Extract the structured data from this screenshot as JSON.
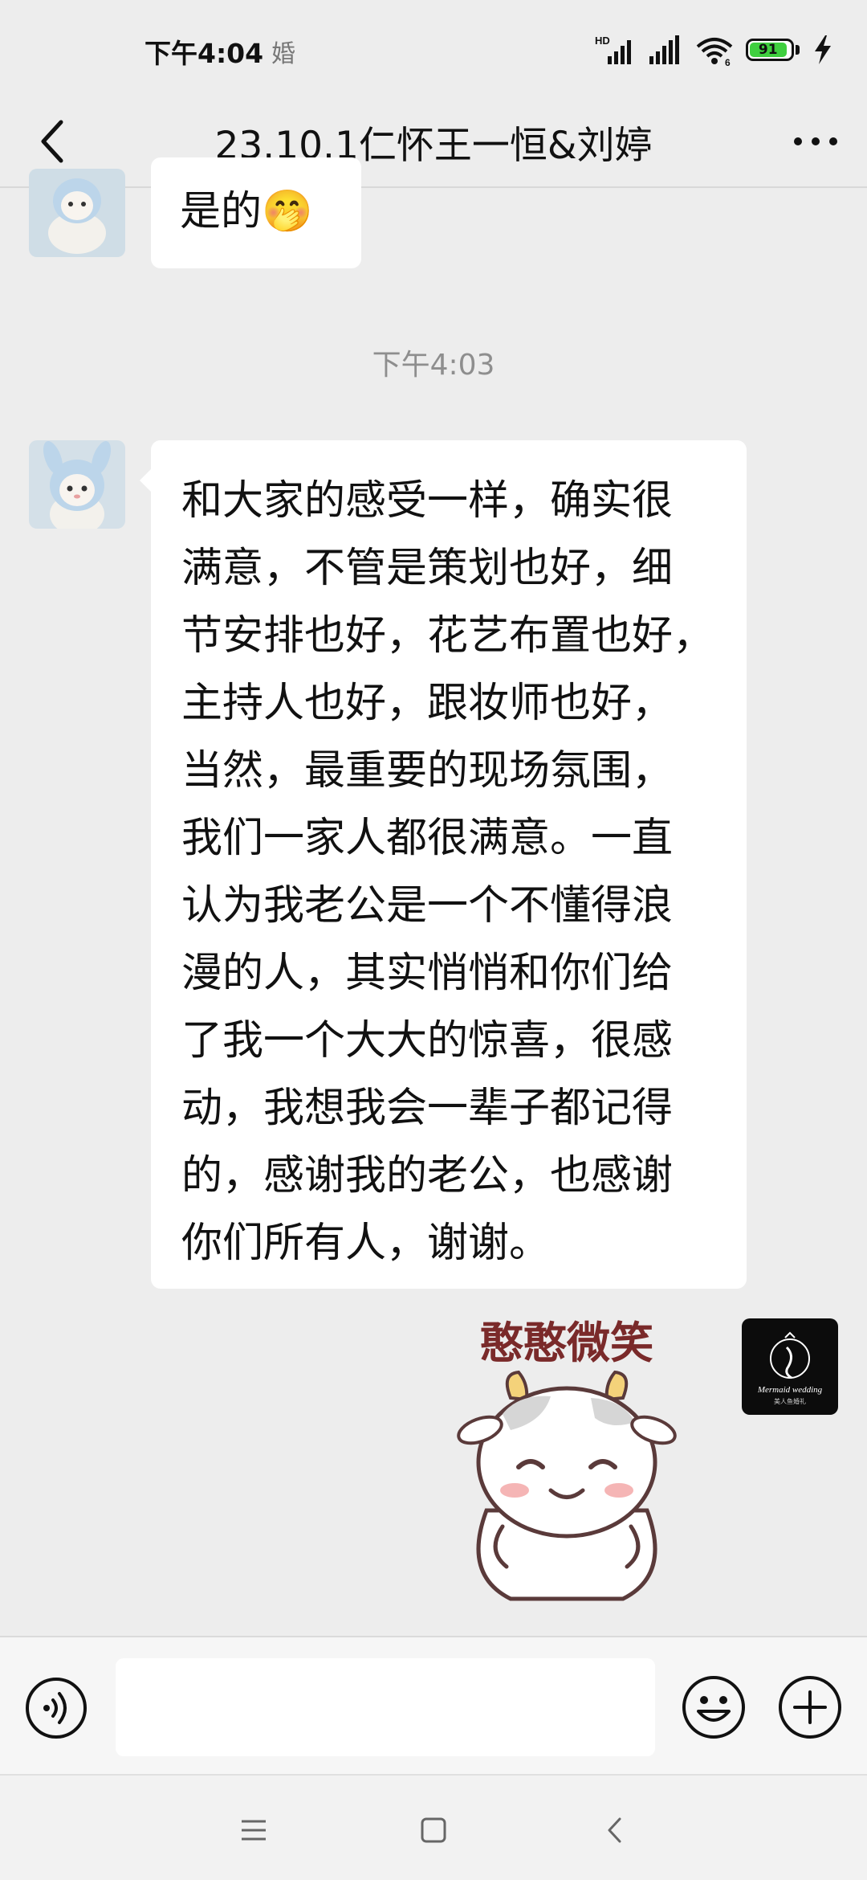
{
  "status_bar": {
    "time": "下午4:04",
    "extra_label": "婚",
    "battery_level": "91",
    "network_label": "HD",
    "wifi_badge": "6"
  },
  "header": {
    "title": "23.10.1仁怀王一恒&刘婷"
  },
  "messages": [
    {
      "text": "是的",
      "emoji": "🤭"
    },
    {
      "timestamp": "下午4:03"
    },
    {
      "lines": [
        "和大家的感受一样，确实很",
        "满意，不管是策划也好，细",
        "节安排也好，花艺布置也好，",
        "主持人也好，跟妆师也好，",
        "当然，最重要的现场氛围，",
        "我们一家人都很满意。一直",
        "认为我老公是一个不懂得浪",
        "漫的人，其实悄悄和你们给",
        "了我一个大大的惊喜，很感",
        "动，我想我会一辈子都记得",
        "的，感谢我的老公，也感谢",
        "你们所有人，谢谢。"
      ]
    },
    {
      "sticker_caption": "憨憨微笑"
    }
  ],
  "my_avatar": {
    "brand_text": "Mermaid wedding",
    "brand_sub": "美人鱼婚礼"
  },
  "input": {
    "value": "",
    "placeholder": ""
  },
  "icons": {
    "back": "chevron-left-icon",
    "more": "more-dots-icon",
    "voice": "voice-icon",
    "emoji": "emoji-icon",
    "plus": "plus-icon",
    "nav_menu": "menu-icon",
    "nav_home": "home-icon",
    "nav_back": "back-icon"
  },
  "colors": {
    "background": "#ededed",
    "bubble": "#ffffff",
    "battery": "#3fcf3f",
    "sticker_text": "#7a2a2a"
  }
}
